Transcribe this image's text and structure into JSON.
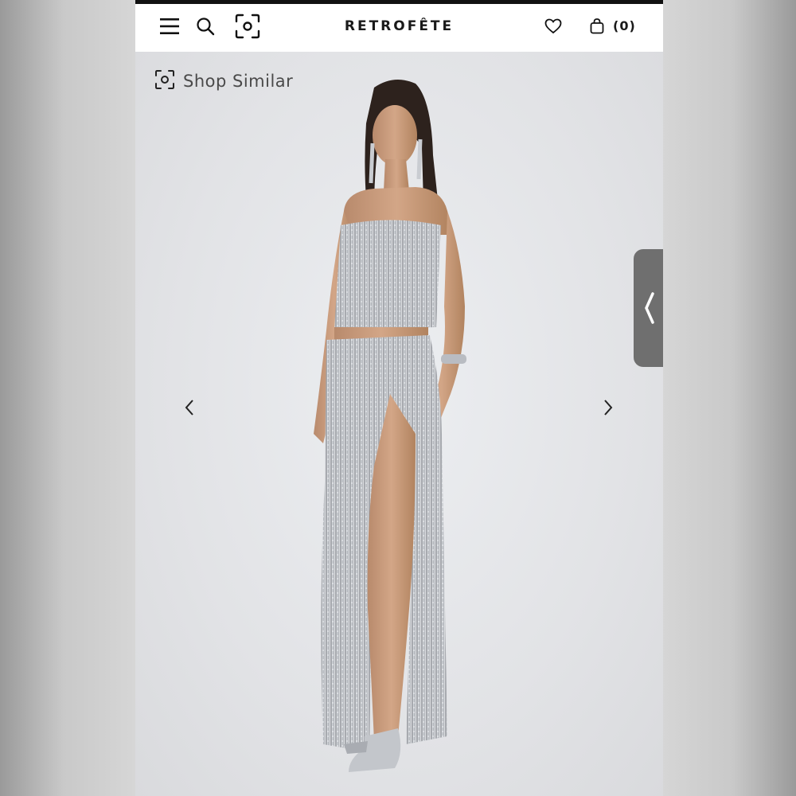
{
  "header": {
    "brand": "RETROFÊTE",
    "bag_count": "(0)",
    "icons": [
      "menu-icon",
      "search-icon",
      "visual-search-icon",
      "heart-icon",
      "bag-icon"
    ]
  },
  "product_image": {
    "shop_similar_label": "Shop Similar",
    "description": "",
    "colors": {
      "background": "#e4e5e8",
      "sequin": "#b8bcc2",
      "skin": "#c99a7c"
    }
  },
  "carousel": {
    "prev_icon": "chevron-left-icon",
    "next_icon": "chevron-right-icon"
  },
  "side_tab": {
    "icon": "chevron-left-icon"
  }
}
